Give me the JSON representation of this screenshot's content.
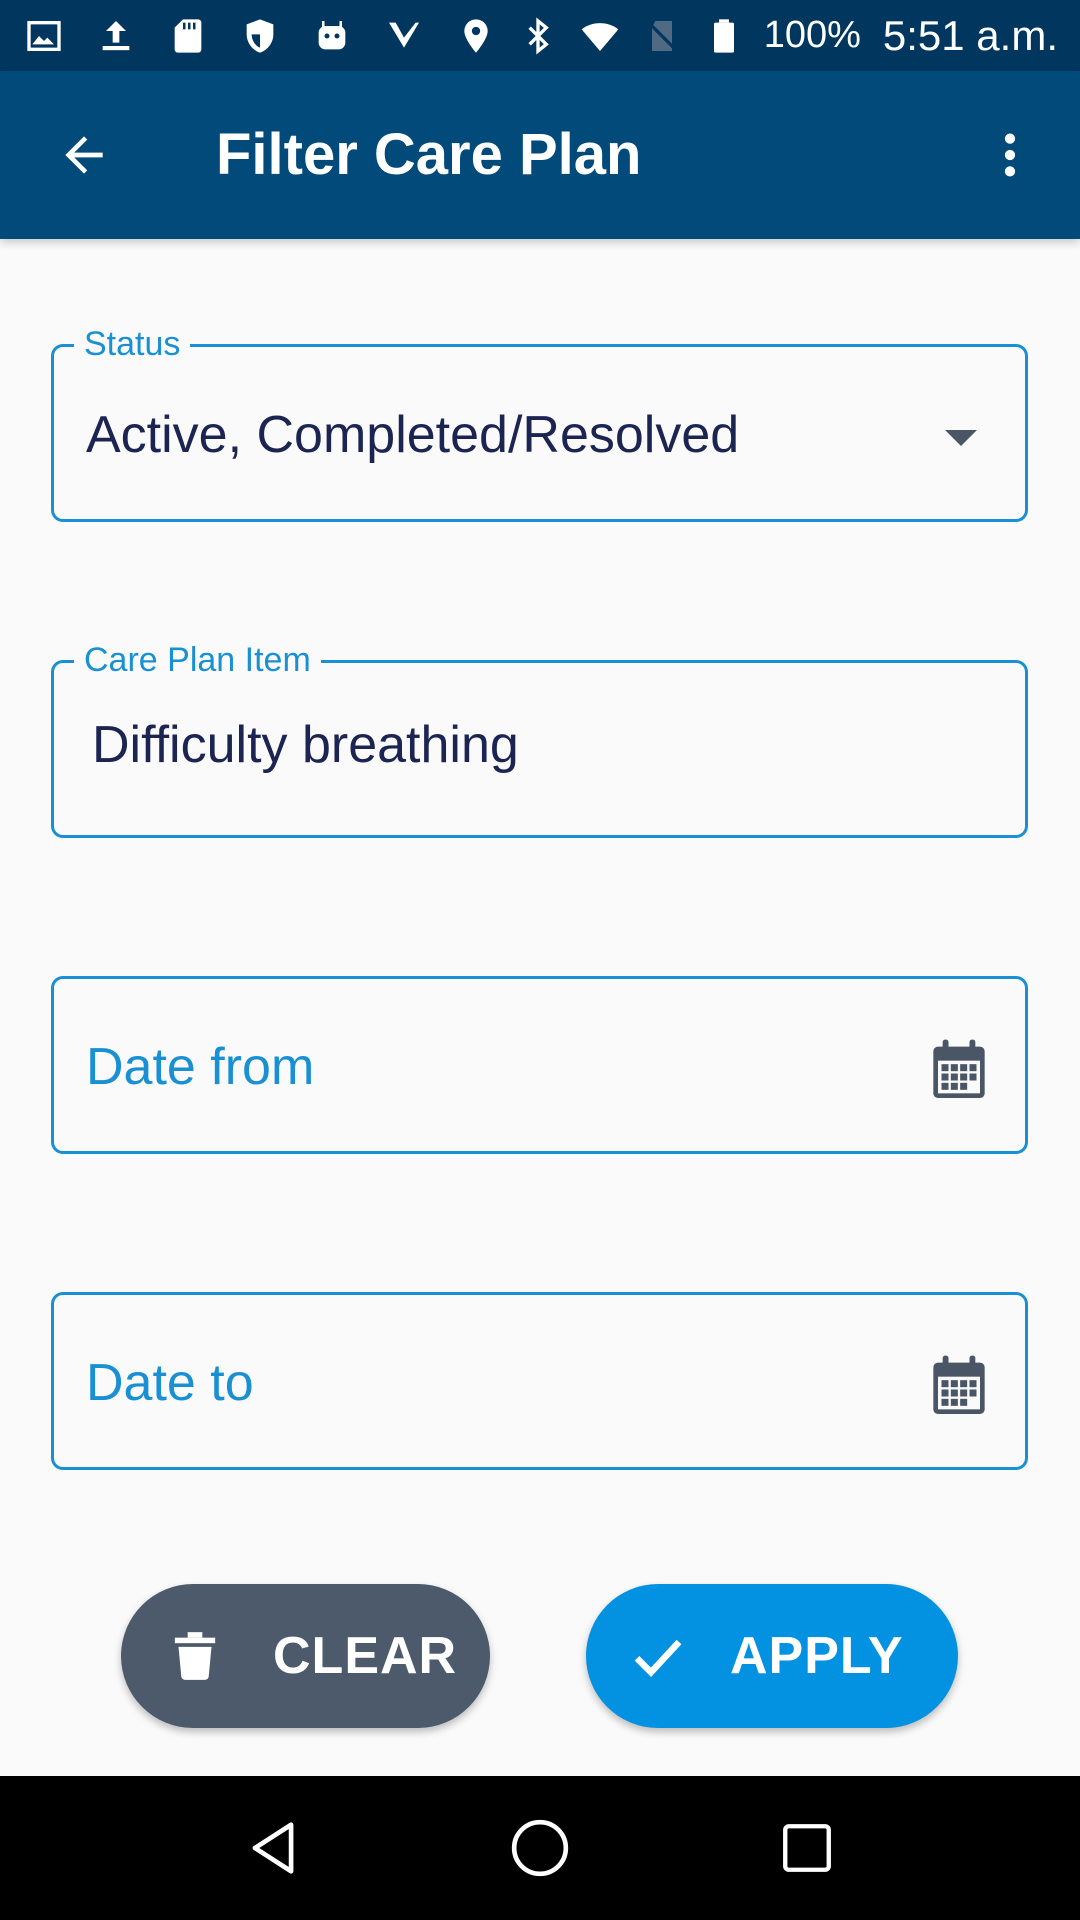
{
  "status_bar": {
    "battery_text": "100%",
    "time": "5:51 a.m.",
    "icons": [
      "image-icon",
      "upload-icon",
      "sd-card-icon",
      "shield-icon",
      "android-icon",
      "task-check-icon",
      "location-icon",
      "bluetooth-icon",
      "wifi-icon",
      "no-sim-icon",
      "battery-icon"
    ]
  },
  "app_bar": {
    "title": "Filter Care Plan",
    "back_icon": "arrow-back-icon",
    "menu_icon": "more-vert-icon"
  },
  "form": {
    "status": {
      "label": "Status",
      "value": "Active, Completed/Resolved",
      "icon": "dropdown-arrow-icon"
    },
    "care_plan_item": {
      "label": "Care Plan Item",
      "value": "Difficulty breathing"
    },
    "date_from": {
      "placeholder": "Date from",
      "icon": "calendar-icon"
    },
    "date_to": {
      "placeholder": "Date to",
      "icon": "calendar-icon"
    }
  },
  "actions": {
    "clear_label": "CLEAR",
    "clear_icon": "trash-icon",
    "apply_label": "APPLY",
    "apply_icon": "check-icon"
  },
  "colors": {
    "status_bar": "#01375f",
    "app_bar": "#014a7a",
    "accent": "#1a90d4",
    "field_text": "#1c2452",
    "clear_button": "#4d5a6c",
    "apply_button": "#0391e1"
  },
  "nav_bar": {
    "icons": [
      "nav-back-icon",
      "nav-home-icon",
      "nav-recents-icon"
    ]
  }
}
